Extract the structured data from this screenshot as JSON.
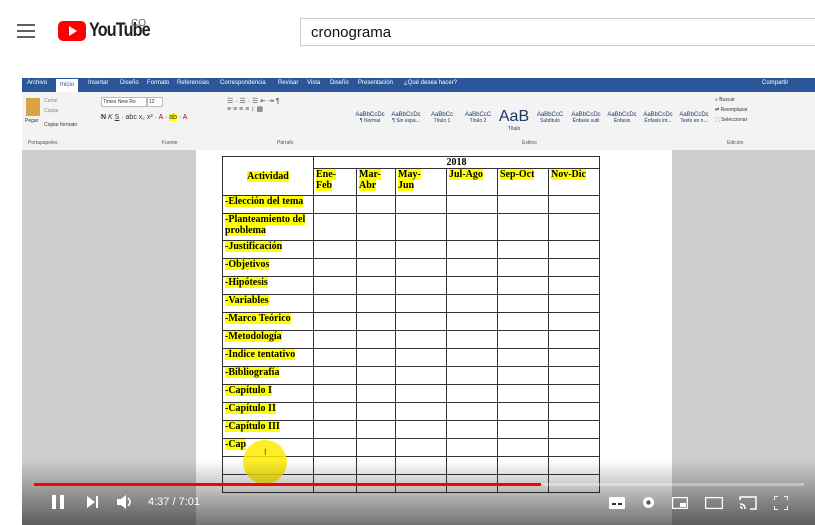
{
  "header": {
    "logo_text": "YouTube",
    "logo_suffix": "CO",
    "search_query": "cronograma"
  },
  "word": {
    "tabs": [
      "Archivo",
      "Inicio",
      "Insertar",
      "Diseño",
      "Formato",
      "Referencias",
      "Correspondencia",
      "Revisar",
      "Vista",
      "Diseño",
      "Presentación"
    ],
    "active_tab": "Inicio",
    "tell_me": "¿Qué desea hacer?",
    "share": "Compartir",
    "clipboard": {
      "paste": "Pegar",
      "cut": "Cortar",
      "copy": "Copiar",
      "format_painter": "Copiar formato",
      "group": "Portapapeles"
    },
    "font": {
      "name": "Times New Ro",
      "size": "12",
      "group": "Fuente"
    },
    "paragraph_group": "Párrafo",
    "styles": [
      {
        "sample": "AaBbCcDc",
        "name": "¶ Normal"
      },
      {
        "sample": "AaBbCcDc",
        "name": "¶ Sin espa..."
      },
      {
        "sample": "AaBbCc",
        "name": "Título 1"
      },
      {
        "sample": "AaBbCcC",
        "name": "Título 2"
      },
      {
        "sample": "AaB",
        "name": "Título"
      },
      {
        "sample": "AaBbCcC",
        "name": "Subtítulo"
      },
      {
        "sample": "AaBbCcDc",
        "name": "Énfasis sutil"
      },
      {
        "sample": "AaBbCcDc",
        "name": "Énfasis"
      },
      {
        "sample": "AaBbCcDc",
        "name": "Énfasis int..."
      },
      {
        "sample": "AaBbCcDc",
        "name": "Texto en n..."
      }
    ],
    "styles_group": "Estilos",
    "editing": {
      "find": "Buscar",
      "replace": "Reemplazar",
      "select": "Seleccionar",
      "group": "Edición"
    }
  },
  "table": {
    "year": "2018",
    "header_activity": "Actividad",
    "periods": [
      "Ene-\nFeb",
      "Mar-\nAbr",
      "May-\nJun",
      "Jul-Ago",
      "Sep-Oct",
      "Nov-Dic"
    ],
    "rows": [
      "-Elección del tema",
      "-Planteamiento del problema",
      "-Justificación",
      "-Objetivos",
      "-Hipótesis",
      "-Variables",
      "-Marco Teórico",
      "-Metodología",
      "-Índice tentativo",
      "-Bibliografía",
      "-Capítulo I",
      "-Capítulo II",
      "-Capítulo III",
      "-Cap",
      "",
      ""
    ]
  },
  "player": {
    "time": "4:37 / 7:01",
    "progress_fraction": 0.658
  }
}
